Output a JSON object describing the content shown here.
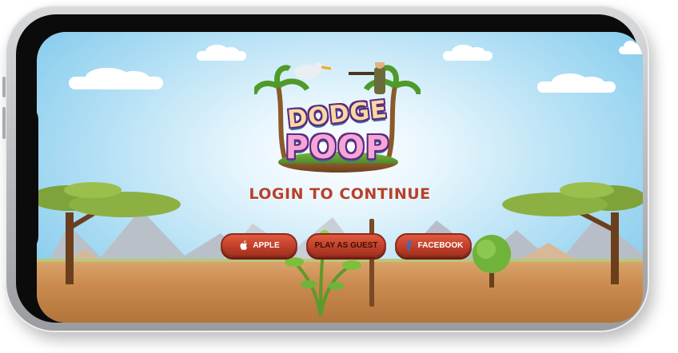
{
  "game": {
    "logo_line1": "DODGE",
    "logo_line2": "POOP",
    "login_title": "LOGIN TO CONTINUE"
  },
  "buttons": {
    "apple": {
      "label": "APPLE",
      "icon": "apple-icon"
    },
    "guest": {
      "label": "PLAY AS GUEST"
    },
    "facebook": {
      "label": "FACEBOOK",
      "icon": "facebook-icon"
    }
  },
  "colors": {
    "title": "#b8412a",
    "button": "#c2402a",
    "sky": "#74c3ea",
    "ground": "#c98a4e"
  }
}
